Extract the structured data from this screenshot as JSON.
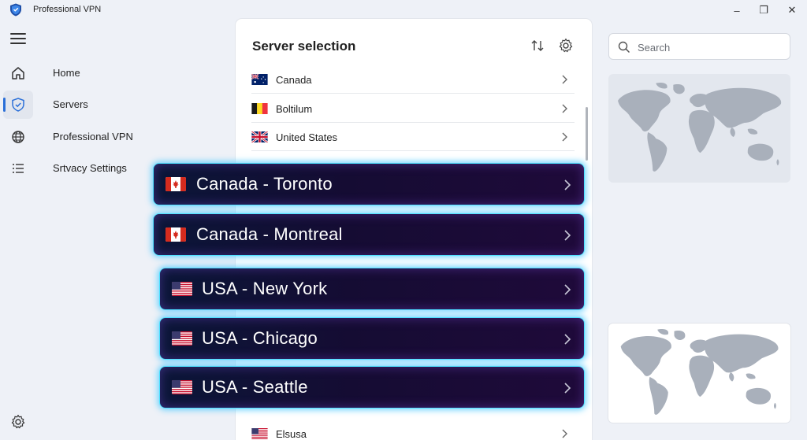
{
  "app": {
    "title": "Professional VPN"
  },
  "window_controls": {
    "minimize": "–",
    "maximize": "❐",
    "close": "✕"
  },
  "sidebar": {
    "items": [
      {
        "label": "Home",
        "icon": "home-icon",
        "active": false
      },
      {
        "label": "Servers",
        "icon": "shield-icon",
        "active": true
      },
      {
        "label": "Professional VPN",
        "icon": "globe-icon",
        "active": false
      },
      {
        "label": "Srtvacy Settings",
        "icon": "list-icon",
        "active": false
      }
    ]
  },
  "server_panel": {
    "title": "Server selection",
    "rows": [
      {
        "label": "Canada",
        "flag": "australia-flag"
      },
      {
        "label": "Boltilum",
        "flag": "belgium-flag"
      },
      {
        "label": "United States",
        "flag": "uk-flag"
      },
      {
        "label": "Elsusa",
        "flag": "usa-flag"
      }
    ]
  },
  "search": {
    "placeholder": "Search",
    "value": ""
  },
  "overlay_cards": [
    {
      "label": "Canada - Toronto",
      "flag": "canada-flag"
    },
    {
      "label": "Canada - Montreal",
      "flag": "canada-flag"
    },
    {
      "label": "USA - New York",
      "flag": "usa-flag"
    },
    {
      "label": "USA - Chicago",
      "flag": "usa-flag"
    },
    {
      "label": "USA - Seattle",
      "flag": "usa-flag"
    }
  ],
  "colors": {
    "accent": "#2a6fd8",
    "glow": "#4de0ff",
    "card_dark": "#150c33",
    "background": "#eef1f7"
  }
}
